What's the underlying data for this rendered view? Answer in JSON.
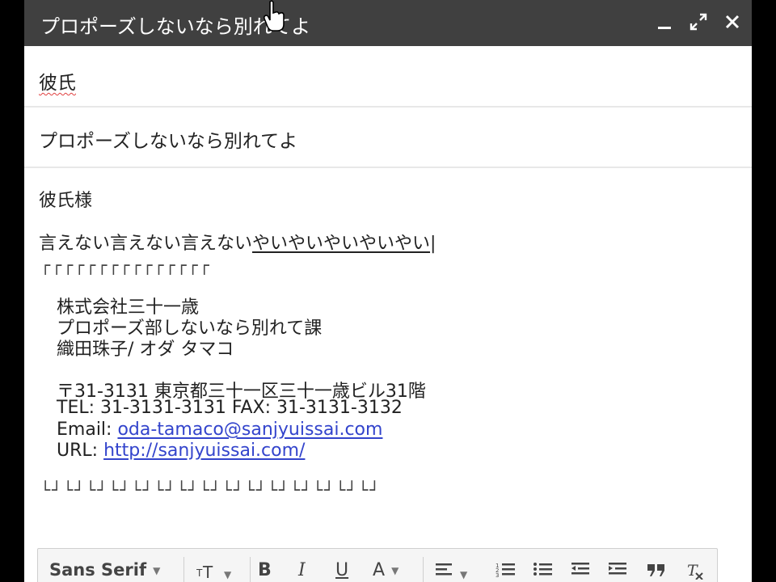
{
  "window": {
    "title": "プロポーズしないなら別れてよ",
    "minimize_icon": "minimize-icon",
    "expand_icon": "expand-icon",
    "close_icon": "close-icon"
  },
  "to": {
    "value": "彼氏"
  },
  "subject": {
    "value": "プロポーズしないなら別れてよ"
  },
  "body": {
    "greeting": "彼氏様",
    "line1_head": "言えない言えない言えない",
    "line1_tail": "やいやいやいやいやい",
    "deco_top": "┌┌┌┌┌┌┌┌┌┌┌┌┌┌┌",
    "company": "株式会社三十一歳",
    "department": "プロポーズ部しないなら別れて課",
    "person": "織田珠子/ オダ タマコ",
    "address": "〒31-3131 東京都三十一区三十一歳ビル31階",
    "telfax": "TEL: 31-3131-3131 FAX: 31-3131-3132",
    "email_label": "Email: ",
    "email_value": "oda-tamaco@sanjyuissai.com",
    "url_label": "URL: ",
    "url_value": "http://sanjyuissai.com/",
    "deco_bottom": "└┘└┘└┘└┘└┘└┘└┘└┘└┘└┘└┘└┘└┘└┘└┘"
  },
  "toolbar": {
    "font_name": "Sans Serif",
    "font_size_icon": "font-size-icon",
    "bold": "B",
    "italic": "I",
    "underline": "U",
    "text_color": "A",
    "align_icon": "align-icon",
    "numbered_list_icon": "numbered-list-icon",
    "bulleted_list_icon": "bulleted-list-icon",
    "indent_less_icon": "indent-less-icon",
    "indent_more_icon": "indent-more-icon",
    "quote_icon": "quote-icon",
    "remove_format_icon": "remove-formatting-icon"
  },
  "colors": {
    "titlebar": "#404040",
    "link": "#3344cc",
    "spell_underline": "#e04040"
  }
}
